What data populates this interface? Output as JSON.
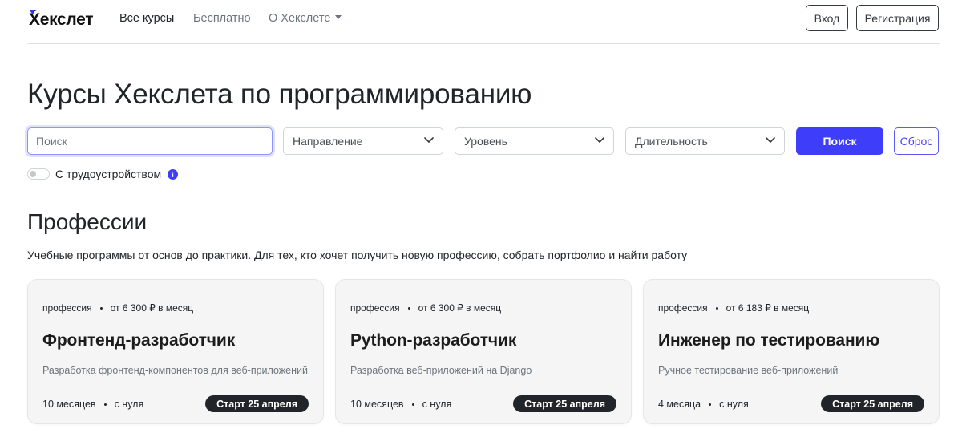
{
  "header": {
    "logo_text": "Хекслет",
    "nav": [
      {
        "label": "Все курсы",
        "active": true
      },
      {
        "label": "Бесплатно",
        "active": false
      },
      {
        "label": "О Хекслете",
        "active": false,
        "dropdown": true
      }
    ],
    "login_label": "Вход",
    "register_label": "Регистрация"
  },
  "page_title": "Курсы Хекслета по программированию",
  "filters": {
    "search_placeholder": "Поиск",
    "direction": "Направление",
    "level": "Уровень",
    "duration": "Длительность",
    "search_button": "Поиск",
    "reset_button": "Сброс",
    "employment_switch_label": "С трудоустройством",
    "employment_switch_on": false
  },
  "section": {
    "title": "Профессии",
    "description": "Учебные программы от основ до практики. Для тех, кто хочет получить новую профессию, собрать портфолио и найти работу"
  },
  "cards": [
    {
      "kind": "профессия",
      "price": "от 6 300 ₽ в месяц",
      "title": "Фронтенд-разработчик",
      "description": "Разработка фронтенд-компонентов для веб-приложений",
      "duration": "10 месяцев",
      "level": "с нуля",
      "start": "Старт 25 апреля"
    },
    {
      "kind": "профессия",
      "price": "от 6 300 ₽ в месяц",
      "title": "Python-разработчик",
      "description": "Разработка веб-приложений на Django",
      "duration": "10 месяцев",
      "level": "с нуля",
      "start": "Старт 25 апреля"
    },
    {
      "kind": "профессия",
      "price": "от 6 183 ₽ в месяц",
      "title": "Инженер по тестированию",
      "description": "Ручное тестирование веб-приложений",
      "duration": "4 месяца",
      "level": "с нуля",
      "start": "Старт 25 апреля"
    }
  ],
  "colors": {
    "primary": "#3d3dfa",
    "dark": "#212529",
    "card_bg": "#f5f5f5",
    "info_icon": "#3d3dfa"
  },
  "icons": [
    "logo-mark-icon",
    "caret-down-icon",
    "chevron-down-icon",
    "info-icon"
  ]
}
